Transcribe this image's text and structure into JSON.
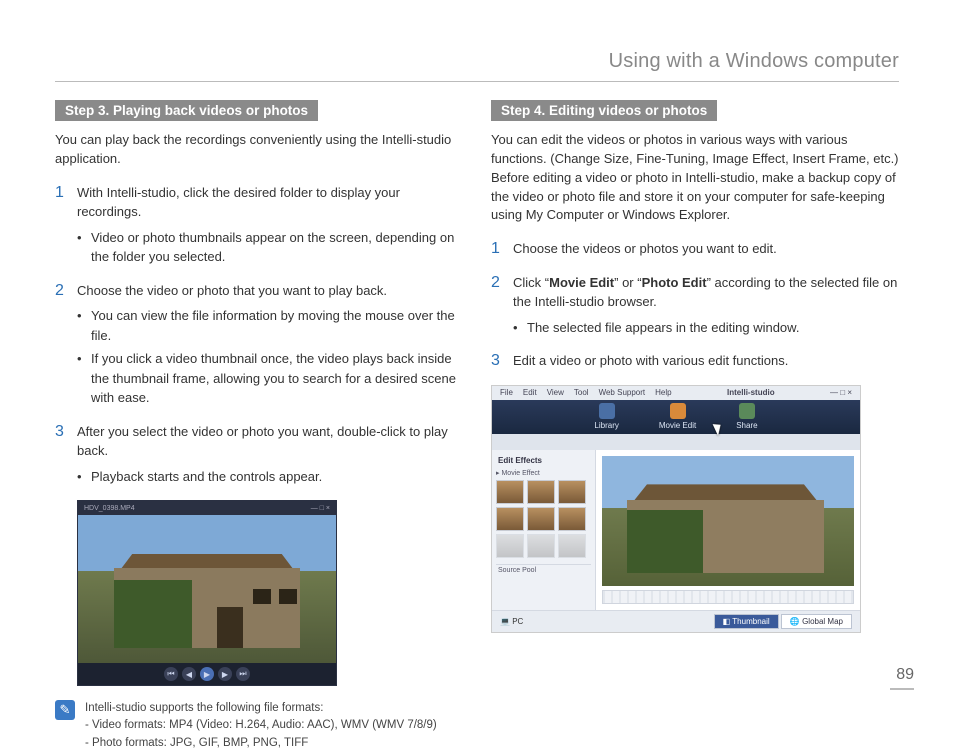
{
  "page_title": "Using with a Windows computer",
  "page_number": "89",
  "left": {
    "step_header": "Step 3. Playing back videos or photos",
    "intro": "You can play back the recordings conveniently using the Intelli-studio application.",
    "steps": [
      {
        "text": "With Intelli-studio, click the desired folder to display your recordings.",
        "bullets": [
          "Video or photo thumbnails appear on the screen, depending on the folder you selected."
        ]
      },
      {
        "text": "Choose the video or photo that you want to play back.",
        "bullets": [
          "You can view the file information by moving the mouse over the file.",
          "If you click a video thumbnail once, the video plays back inside the thumbnail frame, allowing you to search for a desired scene with ease."
        ]
      },
      {
        "text": "After you select the video or photo you want, double-click to play back.",
        "bullets": [
          "Playback starts and the controls appear."
        ]
      }
    ],
    "player_title": "HDV_0398.MP4",
    "note": {
      "line1": "Intelli-studio supports the following file formats:",
      "line2": "- Video formats: MP4 (Video: H.264, Audio: AAC), WMV (WMV 7/8/9)",
      "line3": "- Photo formats: JPG, GIF, BMP, PNG, TIFF"
    }
  },
  "right": {
    "step_header": "Step 4. Editing videos or photos",
    "intro": "You can edit the videos or photos in various ways with various functions. (Change Size, Fine-Tuning, Image Effect, Insert Frame, etc.) Before editing a video or photo in Intelli-studio, make a backup copy of the video or photo file and store it on your computer for safe-keeping using My Computer or Windows Explorer.",
    "steps": [
      {
        "text": "Choose the videos or photos you want to edit.",
        "bullets": []
      },
      {
        "text_pre": "Click “",
        "bold1": "Movie Edit",
        "text_mid1": "” or “",
        "bold2": "Photo Edit",
        "text_post": "” according to the selected file on the Intelli-studio browser.",
        "bullets": [
          "The selected file appears in the editing window."
        ]
      },
      {
        "text": "Edit a video or photo with various edit functions.",
        "bullets": []
      }
    ],
    "editor": {
      "logo": "Intelli-studio",
      "menu": [
        "File",
        "Edit",
        "View",
        "Tool",
        "Web Support",
        "Help"
      ],
      "nav": [
        "Library",
        "Movie Edit",
        "Share"
      ],
      "side_title": "Edit Effects",
      "side_group": "Movie Effect",
      "source_panel": "Source Pool",
      "pc_label": "PC",
      "tab_thumb": "Thumbnail",
      "tab_map": "Global Map"
    }
  }
}
